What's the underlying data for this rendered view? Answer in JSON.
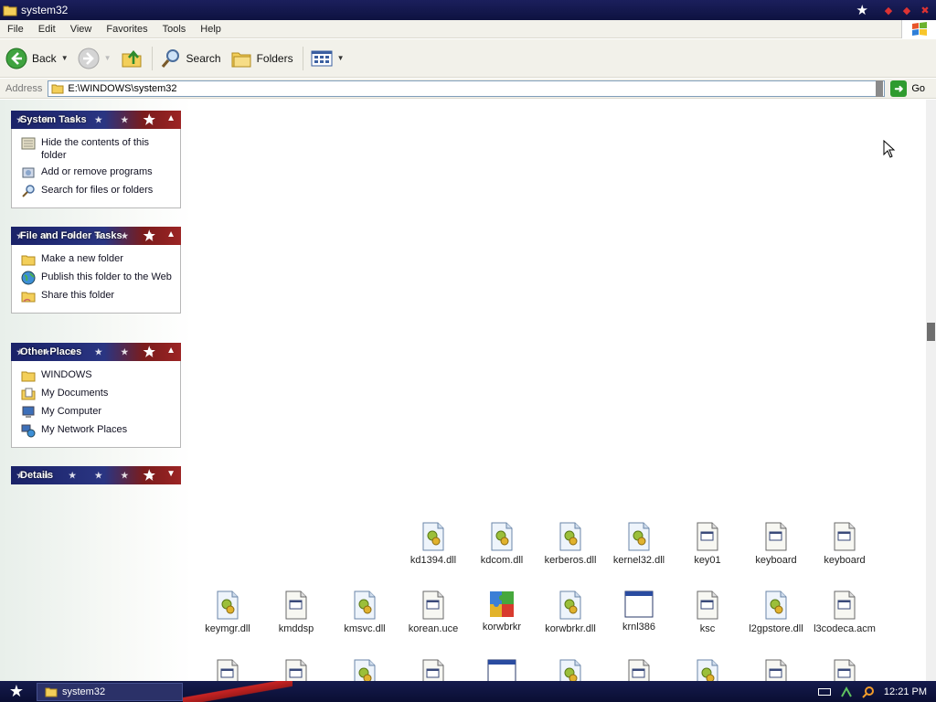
{
  "window": {
    "title": "system32"
  },
  "menu": [
    "File",
    "Edit",
    "View",
    "Favorites",
    "Tools",
    "Help"
  ],
  "toolbar": {
    "back_label": "Back",
    "search_label": "Search",
    "folders_label": "Folders"
  },
  "address": {
    "label": "Address",
    "value": "E:\\WINDOWS\\system32",
    "go_label": "Go"
  },
  "panels": {
    "system_tasks": {
      "title": "System Tasks",
      "items": [
        "Hide the contents of this folder",
        "Add or remove programs",
        "Search for files or folders"
      ]
    },
    "file_folder_tasks": {
      "title": "File and Folder Tasks",
      "items": [
        "Make a new folder",
        "Publish this folder to the Web",
        "Share this folder"
      ]
    },
    "other_places": {
      "title": "Other Places",
      "items": [
        "WINDOWS",
        "My Documents",
        "My Computer",
        "My Network Places"
      ]
    },
    "details": {
      "title": "Details"
    }
  },
  "files_row1": [
    {
      "name": "kd1394.dll",
      "icon": "dll-icon"
    },
    {
      "name": "kdcom.dll",
      "icon": "dll-icon"
    },
    {
      "name": "kerberos.dll",
      "icon": "dll-icon"
    },
    {
      "name": "kernel32.dll",
      "icon": "dll-icon"
    },
    {
      "name": "key01",
      "icon": "system-file-icon"
    },
    {
      "name": "keyboard",
      "icon": "system-file-icon"
    },
    {
      "name": "keyboard",
      "icon": "system-file-icon"
    }
  ],
  "files_row2": [
    {
      "name": "keymgr.dll",
      "icon": "dll-icon"
    },
    {
      "name": "kmddsp",
      "icon": "system-file-icon"
    },
    {
      "name": "kmsvc.dll",
      "icon": "dll-icon"
    },
    {
      "name": "korean.uce",
      "icon": "system-file-icon"
    },
    {
      "name": "korwbrkr",
      "icon": "puzzle-icon"
    },
    {
      "name": "korwbrkr.dll",
      "icon": "dll-icon"
    },
    {
      "name": "krnl386",
      "icon": "app-window-icon"
    },
    {
      "name": "ksc",
      "icon": "system-file-icon"
    },
    {
      "name": "l2gpstore.dll",
      "icon": "dll-icon"
    },
    {
      "name": "l3codeca.acm",
      "icon": "system-file-icon"
    }
  ],
  "taskbar": {
    "task_label": "system32",
    "clock": "12:21 PM"
  }
}
